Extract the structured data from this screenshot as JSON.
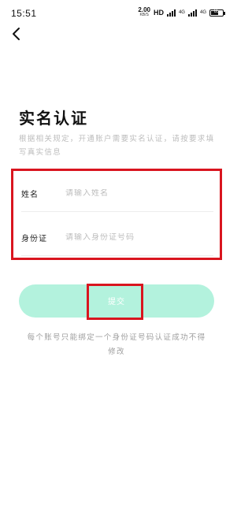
{
  "status_bar": {
    "time": "15:51",
    "net_speed": "2.00",
    "net_speed_unit": "KB/S",
    "hd_label": "HD",
    "network_1": "4G",
    "network_2": "4G",
    "battery_level": "65"
  },
  "header": {
    "back_icon": "chevron-left-icon"
  },
  "page": {
    "title": "实名认证",
    "description": "根据相关规定，开通账户需要实名认证，请按要求填写真实信息"
  },
  "form": {
    "name_label": "姓名",
    "name_placeholder": "请输入姓名",
    "id_label": "身份证",
    "id_placeholder": "请输入身份证号码"
  },
  "submit": {
    "label": "提交"
  },
  "note": "每个账号只能绑定一个身份证号码认证成功不得修改",
  "colors": {
    "accent": "#b3f2dd",
    "highlight": "#d9151f",
    "muted_text": "#bdbdbd"
  }
}
